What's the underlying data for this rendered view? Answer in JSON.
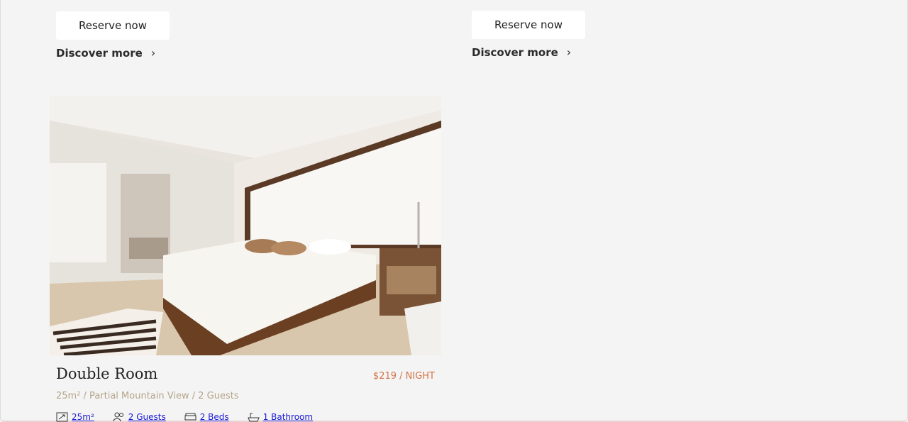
{
  "cards_top": [
    {
      "reserve_label": "Reserve now",
      "discover_label": "Discover more",
      "chevron": "chevron-right-icon"
    },
    {
      "reserve_label": "Reserve now",
      "discover_label": "Discover more",
      "chevron": "chevron-right-icon"
    }
  ],
  "room": {
    "title": "Double Room",
    "price": "$219 / NIGHT",
    "subtitle": "25m² / Partial Mountain View / 2 Guests",
    "amenities": [
      {
        "icon": "area-icon",
        "label": "25m²"
      },
      {
        "icon": "guests-icon",
        "label": "2 Guests"
      },
      {
        "icon": "bed-icon",
        "label": "2 Beds"
      },
      {
        "icon": "bath-icon",
        "label": "1 Bathroom"
      }
    ]
  },
  "colors": {
    "background": "#f4f4f4",
    "price": "#d4744a",
    "subtitle": "#b4a68a",
    "amenity_link": "#1a1ad6"
  }
}
